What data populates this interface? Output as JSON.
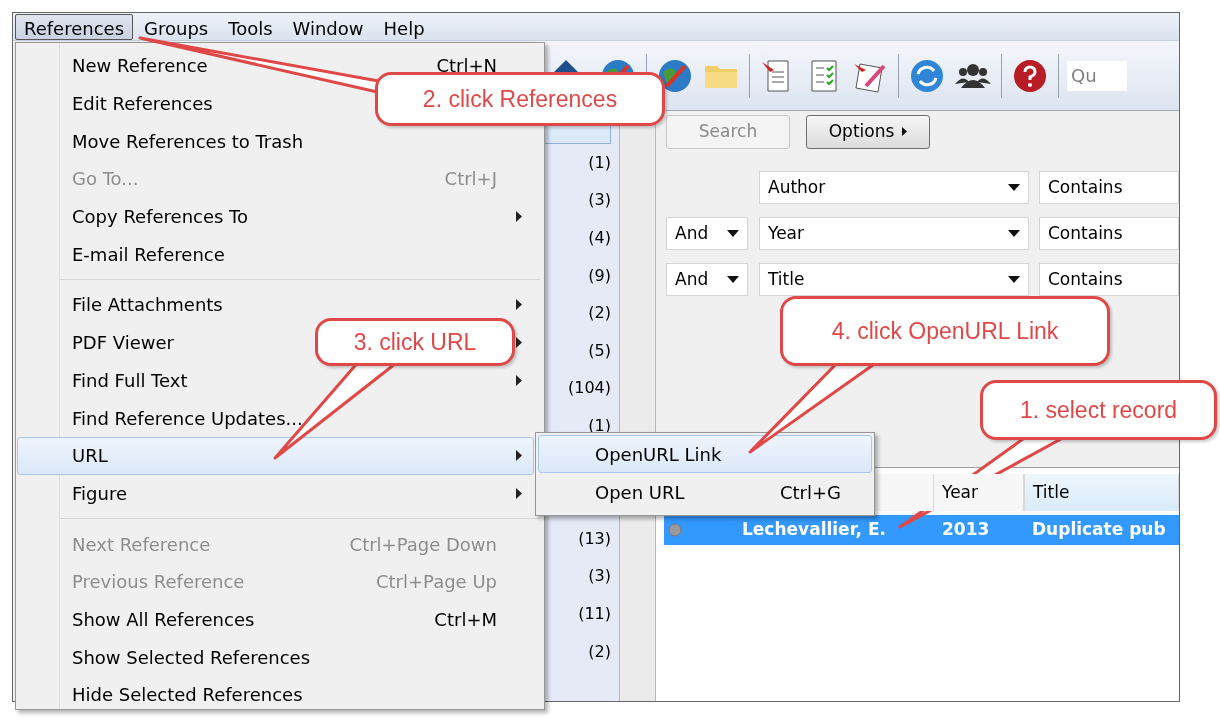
{
  "menubar": [
    {
      "label": "References",
      "selected": true
    },
    {
      "label": "Groups",
      "selected": false
    },
    {
      "label": "Tools",
      "selected": false
    },
    {
      "label": "Window",
      "selected": false
    },
    {
      "label": "Help",
      "selected": false
    }
  ],
  "toolbar": {
    "quick_search_placeholder": "Qu"
  },
  "menu": {
    "items": [
      {
        "kind": "item",
        "label": "New Reference",
        "shortcut": "Ctrl+N",
        "submenu": false,
        "disabled": false,
        "selected": false
      },
      {
        "kind": "item",
        "label": "Edit References",
        "disabled": false,
        "selected": false
      },
      {
        "kind": "item",
        "label": "Move References to Trash",
        "submenu": false,
        "disabled": false,
        "selected": false
      },
      {
        "kind": "item",
        "label": "Go To...",
        "shortcut": "Ctrl+J",
        "submenu": false,
        "disabled": true,
        "selected": false
      },
      {
        "kind": "item",
        "label": "Copy References To",
        "submenu": true,
        "disabled": false,
        "selected": false
      },
      {
        "kind": "item",
        "label": "E-mail Reference",
        "submenu": false,
        "disabled": false,
        "selected": false
      },
      {
        "kind": "separator"
      },
      {
        "kind": "item",
        "label": "File Attachments",
        "submenu": true,
        "disabled": false,
        "selected": false
      },
      {
        "kind": "item",
        "label": "PDF Viewer",
        "submenu": true,
        "disabled": false,
        "selected": false
      },
      {
        "kind": "item",
        "label": "Find Full Text",
        "submenu": true,
        "disabled": false,
        "selected": false
      },
      {
        "kind": "item",
        "label": "Find Reference Updates...",
        "submenu": false,
        "disabled": false,
        "selected": false
      },
      {
        "kind": "item",
        "label": "URL",
        "submenu": true,
        "disabled": false,
        "selected": true
      },
      {
        "kind": "item",
        "label": "Figure",
        "submenu": true,
        "disabled": false,
        "selected": false
      },
      {
        "kind": "separator"
      },
      {
        "kind": "item",
        "label": "Next Reference",
        "shortcut": "Ctrl+Page Down",
        "submenu": false,
        "disabled": true,
        "selected": false
      },
      {
        "kind": "item",
        "label": "Previous Reference",
        "shortcut": "Ctrl+Page Up",
        "submenu": false,
        "disabled": true,
        "selected": false
      },
      {
        "kind": "item",
        "label": "Show All References",
        "shortcut": "Ctrl+M",
        "submenu": false,
        "disabled": false,
        "selected": false
      },
      {
        "kind": "item",
        "label": "Show Selected References",
        "submenu": false,
        "disabled": false,
        "selected": false
      },
      {
        "kind": "item",
        "label": "Hide Selected References",
        "submenu": false,
        "disabled": false,
        "selected": false
      }
    ]
  },
  "submenu": {
    "items": [
      {
        "label": "OpenURL Link",
        "selected": true
      },
      {
        "label": "Open URL",
        "shortcut": "Ctrl+G",
        "selected": false
      }
    ]
  },
  "group_counts_upper": [
    "(1)",
    "(3)",
    "(4)",
    "(9)",
    "(2)",
    "(5)",
    "(104)",
    "(1)"
  ],
  "group_counts_lower": [
    "(13)",
    "(3)",
    "(11)",
    "(2)"
  ],
  "search": {
    "buttons": [
      {
        "label": "Search",
        "disabled": true,
        "caret": false
      },
      {
        "label": "Options",
        "disabled": false,
        "caret": true
      }
    ],
    "rows": [
      {
        "field": "Author",
        "operator": "Contains"
      },
      {
        "connector": "And",
        "field": "Year",
        "operator": "Contains"
      },
      {
        "connector": "And",
        "field": "Title",
        "operator": "Contains"
      }
    ]
  },
  "table": {
    "columns": [
      "",
      "Year",
      "Title"
    ],
    "rows": [
      {
        "selected": true,
        "cells": [
          "Lechevallier, E.",
          "2013",
          "Duplicate pub"
        ]
      }
    ]
  },
  "callouts": [
    {
      "text": "2. click References"
    },
    {
      "text": "3. click URL"
    },
    {
      "text": "4. click OpenURL Link"
    },
    {
      "text": "1. select record"
    }
  ]
}
